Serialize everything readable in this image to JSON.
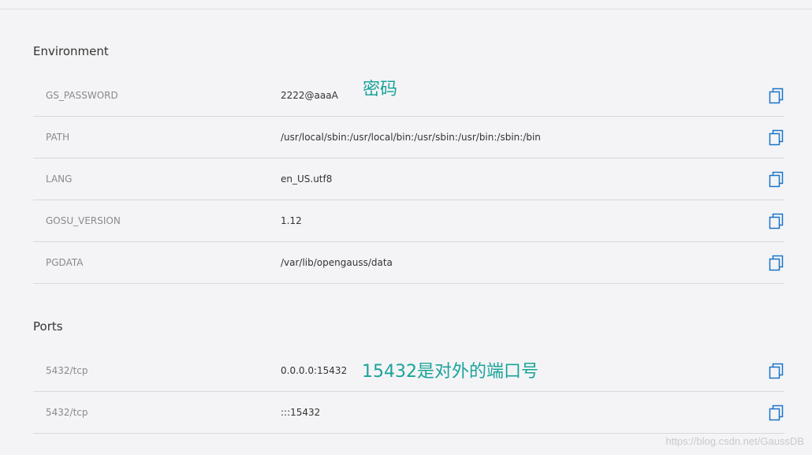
{
  "environment": {
    "title": "Environment",
    "rows": [
      {
        "key": "GS_PASSWORD",
        "value": "2222@aaaA"
      },
      {
        "key": "PATH",
        "value": "/usr/local/sbin:/usr/local/bin:/usr/sbin:/usr/bin:/sbin:/bin"
      },
      {
        "key": "LANG",
        "value": "en_US.utf8"
      },
      {
        "key": "GOSU_VERSION",
        "value": "1.12"
      },
      {
        "key": "PGDATA",
        "value": "/var/lib/opengauss/data"
      }
    ]
  },
  "ports": {
    "title": "Ports",
    "rows": [
      {
        "key": "5432/tcp",
        "value": "0.0.0.0:15432"
      },
      {
        "key": "5432/tcp",
        "value": ":::15432"
      }
    ]
  },
  "annotations": {
    "password_note": "密码",
    "port_note": "15432是对外的端口号"
  },
  "watermark": "https://blog.csdn.net/GaussDB",
  "icons": {
    "copy": "copy-icon"
  },
  "colors": {
    "accent": "#1a73c9",
    "annotation": "#1aa39a"
  }
}
